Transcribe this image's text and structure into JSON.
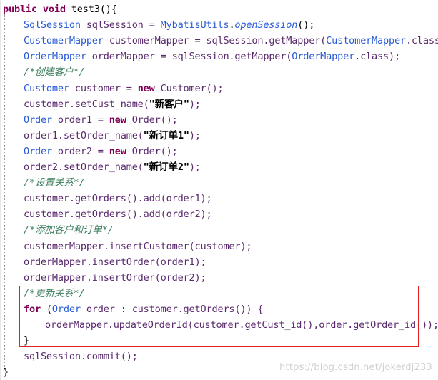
{
  "editor": {
    "lines": [
      [
        {
          "t": "public",
          "c": "kw"
        },
        {
          "t": " ",
          "c": "plain"
        },
        {
          "t": "void",
          "c": "kw"
        },
        {
          "t": " test3(){",
          "c": "plain"
        }
      ],
      [
        {
          "t": "SqlSession",
          "c": "type-blue"
        },
        {
          "t": " sqlSession = ",
          "c": "ident"
        },
        {
          "t": "MybatisUtils",
          "c": "type-blue"
        },
        {
          "t": ".",
          "c": "plain"
        },
        {
          "t": "openSession",
          "c": "static"
        },
        {
          "t": "();",
          "c": "plain"
        }
      ],
      [
        {
          "t": "CustomerMapper",
          "c": "type-blue"
        },
        {
          "t": " customerMapper = sqlSession.getMapper(",
          "c": "ident"
        },
        {
          "t": "CustomerMapper",
          "c": "type-blue"
        },
        {
          "t": ".class);",
          "c": "ident"
        }
      ],
      [
        {
          "t": "OrderMapper",
          "c": "type-blue"
        },
        {
          "t": " orderMapper = sqlSession.getMapper(",
          "c": "ident"
        },
        {
          "t": "OrderMapper",
          "c": "type-blue"
        },
        {
          "t": ".class);",
          "c": "ident"
        }
      ],
      [
        {
          "t": "/*创建客户*/",
          "c": "comment"
        }
      ],
      [
        {
          "t": "Customer",
          "c": "type-blue"
        },
        {
          "t": " customer = ",
          "c": "ident"
        },
        {
          "t": "new",
          "c": "kw"
        },
        {
          "t": " Customer();",
          "c": "ident"
        }
      ],
      [
        {
          "t": "customer.setCust_name(",
          "c": "ident"
        },
        {
          "t": "\"新客户\"",
          "c": "string"
        },
        {
          "t": ");",
          "c": "ident"
        }
      ],
      [
        {
          "t": "Order",
          "c": "type-blue"
        },
        {
          "t": " order1 = ",
          "c": "ident"
        },
        {
          "t": "new",
          "c": "kw"
        },
        {
          "t": " Order();",
          "c": "ident"
        }
      ],
      [
        {
          "t": "order1.setOrder_name(",
          "c": "ident"
        },
        {
          "t": "\"新订单1\"",
          "c": "string"
        },
        {
          "t": ");",
          "c": "ident"
        }
      ],
      [
        {
          "t": "Order",
          "c": "type-blue"
        },
        {
          "t": " order2 = ",
          "c": "ident"
        },
        {
          "t": "new",
          "c": "kw"
        },
        {
          "t": " Order();",
          "c": "ident"
        }
      ],
      [
        {
          "t": "order2.setOrder_name(",
          "c": "ident"
        },
        {
          "t": "\"新订单2\"",
          "c": "string"
        },
        {
          "t": ");",
          "c": "ident"
        }
      ],
      [
        {
          "t": "/*设置关系*/",
          "c": "comment"
        }
      ],
      [
        {
          "t": "customer.getOrders().add(order1);",
          "c": "ident"
        }
      ],
      [
        {
          "t": "customer.getOrders().add(order2);",
          "c": "ident"
        }
      ],
      [
        {
          "t": "/*添加客户和订单*/",
          "c": "comment"
        }
      ],
      [
        {
          "t": "customerMapper.insertCustomer(customer);",
          "c": "ident"
        }
      ],
      [
        {
          "t": "orderMapper.insertOrder(order1);",
          "c": "ident"
        }
      ],
      [
        {
          "t": "orderMapper.insertOrder(order2);",
          "c": "ident"
        }
      ],
      [
        {
          "t": "/*更新关系*/",
          "c": "comment"
        }
      ],
      [
        {
          "t": "for",
          "c": "kw"
        },
        {
          "t": " (",
          "c": "plain"
        },
        {
          "t": "Order",
          "c": "type-blue"
        },
        {
          "t": " order : customer.getOrders()) {",
          "c": "ident"
        }
      ],
      [
        {
          "t": "orderMapper.updateOrderId(customer.getCust_id(),order.getOrder_id());",
          "c": "ident"
        }
      ],
      [
        {
          "t": "}",
          "c": "plain"
        }
      ],
      [
        {
          "t": "sqlSession.commit();",
          "c": "ident"
        }
      ],
      [
        {
          "t": "}",
          "c": "plain"
        }
      ]
    ]
  },
  "watermark": "https://blog.csdn.net/jokerdj233",
  "colors": {
    "keyword": "#7f0055",
    "type": "#2a5bd7",
    "comment": "#3f7f5f",
    "highlight_border": "#e02020"
  }
}
